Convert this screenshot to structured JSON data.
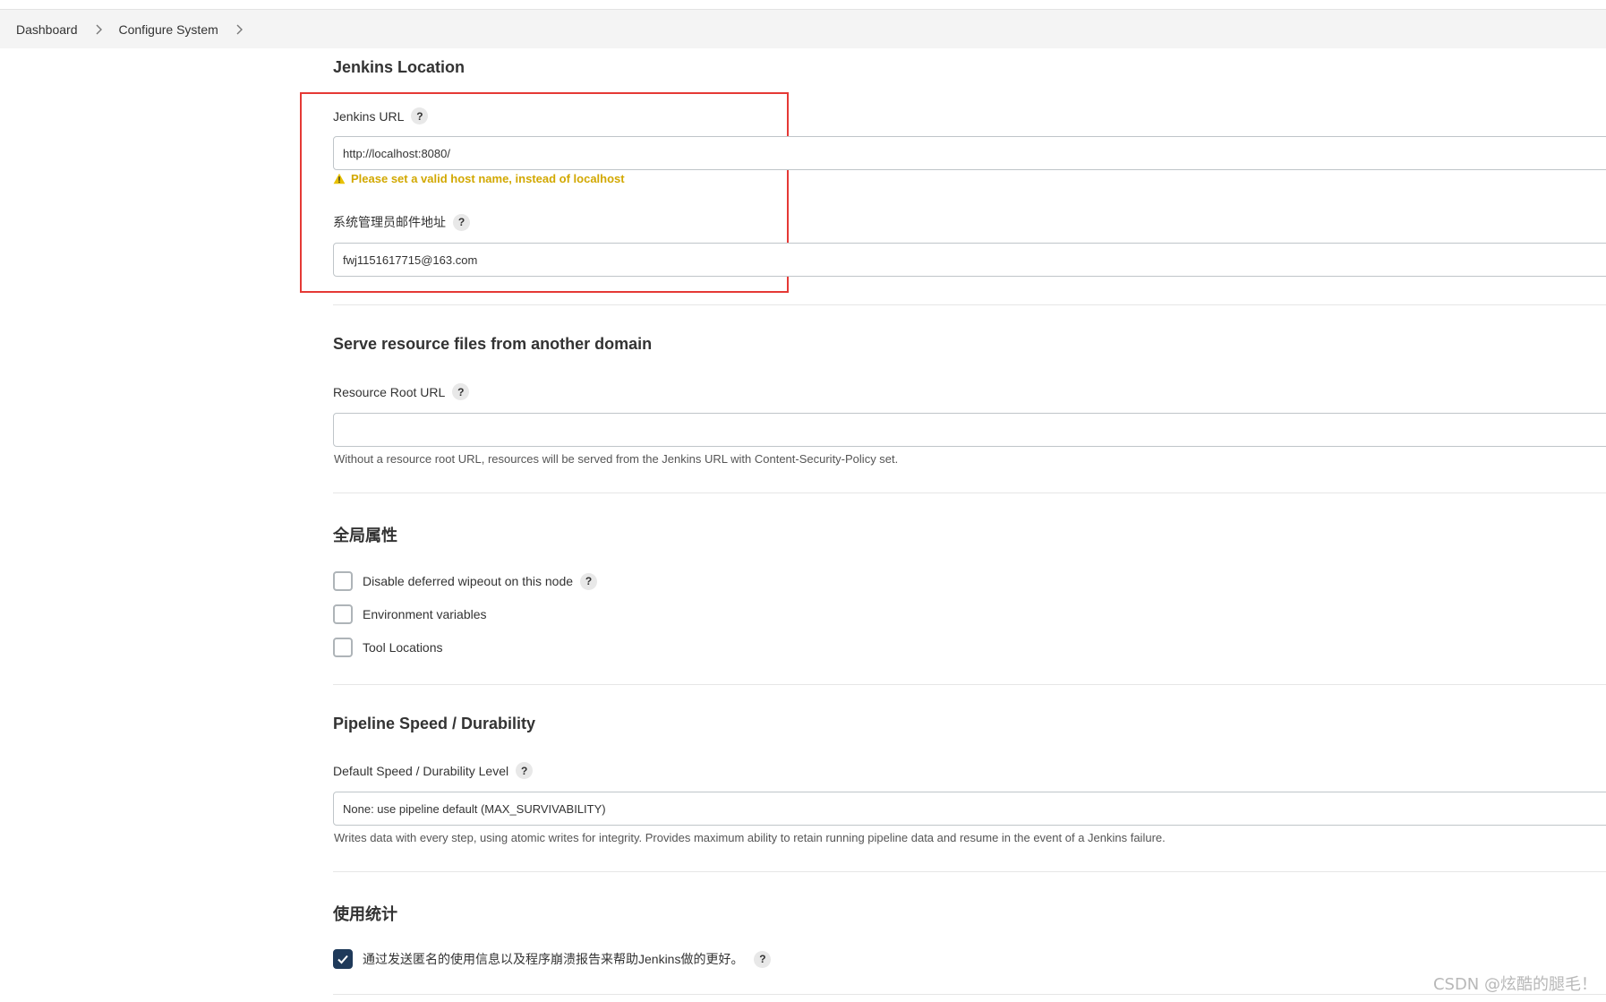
{
  "breadcrumb": {
    "items": [
      "Dashboard",
      "Configure System"
    ]
  },
  "jenkins_location": {
    "title": "Jenkins Location",
    "url_label": "Jenkins URL",
    "url_value": "http://localhost:8080/",
    "warning": "Please set a valid host name, instead of localhost",
    "email_label": "系统管理员邮件地址",
    "email_value": "fwj1151617715@163.com"
  },
  "resource_domain": {
    "title": "Serve resource files from another domain",
    "root_url_label": "Resource Root URL",
    "root_url_value": "",
    "hint": "Without a resource root URL, resources will be served from the Jenkins URL with Content-Security-Policy set."
  },
  "global_properties": {
    "title": "全局属性",
    "options": [
      {
        "label": "Disable deferred wipeout on this node",
        "checked": false,
        "help": true
      },
      {
        "label": "Environment variables",
        "checked": false,
        "help": false
      },
      {
        "label": "Tool Locations",
        "checked": false,
        "help": false
      }
    ]
  },
  "pipeline_speed": {
    "title": "Pipeline Speed / Durability",
    "level_label": "Default Speed / Durability Level",
    "level_value": "None: use pipeline default (MAX_SURVIVABILITY)",
    "hint": "Writes data with every step, using atomic writes for integrity.  Provides maximum ability to retain running pipeline data and resume in the event of a Jenkins failure."
  },
  "usage_stats": {
    "title": "使用统计",
    "option_label": "通过发送匿名的使用信息以及程序崩溃报告来帮助Jenkins做的更好。",
    "checked": true
  },
  "help_glyph": "?",
  "watermark": "CSDN @炫酷的腿毛！",
  "colors": {
    "warning": "#d2a800",
    "highlight": "#e53935",
    "checkbox_checked": "#1f3a5a"
  }
}
